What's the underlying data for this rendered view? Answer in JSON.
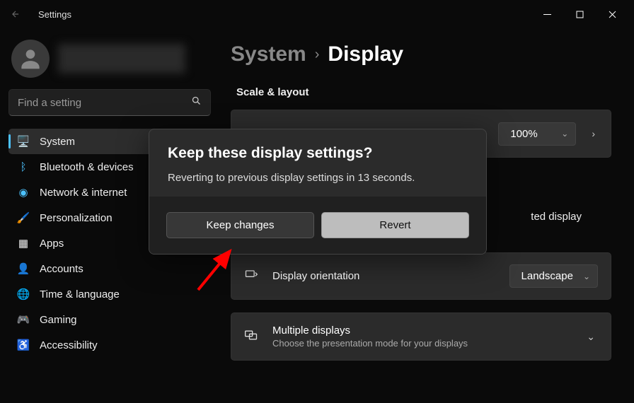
{
  "app": {
    "title": "Settings"
  },
  "search": {
    "placeholder": "Find a setting"
  },
  "nav": {
    "items": [
      {
        "label": "System"
      },
      {
        "label": "Bluetooth & devices"
      },
      {
        "label": "Network & internet"
      },
      {
        "label": "Personalization"
      },
      {
        "label": "Apps"
      },
      {
        "label": "Accounts"
      },
      {
        "label": "Time & language"
      },
      {
        "label": "Gaming"
      },
      {
        "label": "Accessibility"
      }
    ]
  },
  "breadcrumb": {
    "parent": "System",
    "current": "Display"
  },
  "section": {
    "scale_layout": "Scale & layout"
  },
  "settings": {
    "scale": {
      "value": "100%"
    },
    "resolution_hint": "ted display",
    "orientation": {
      "label": "Display orientation",
      "value": "Landscape"
    },
    "multiple": {
      "label": "Multiple displays",
      "desc": "Choose the presentation mode for your displays"
    }
  },
  "dialog": {
    "title": "Keep these display settings?",
    "message": "Reverting to previous display settings in 13 seconds.",
    "keep": "Keep changes",
    "revert": "Revert"
  }
}
